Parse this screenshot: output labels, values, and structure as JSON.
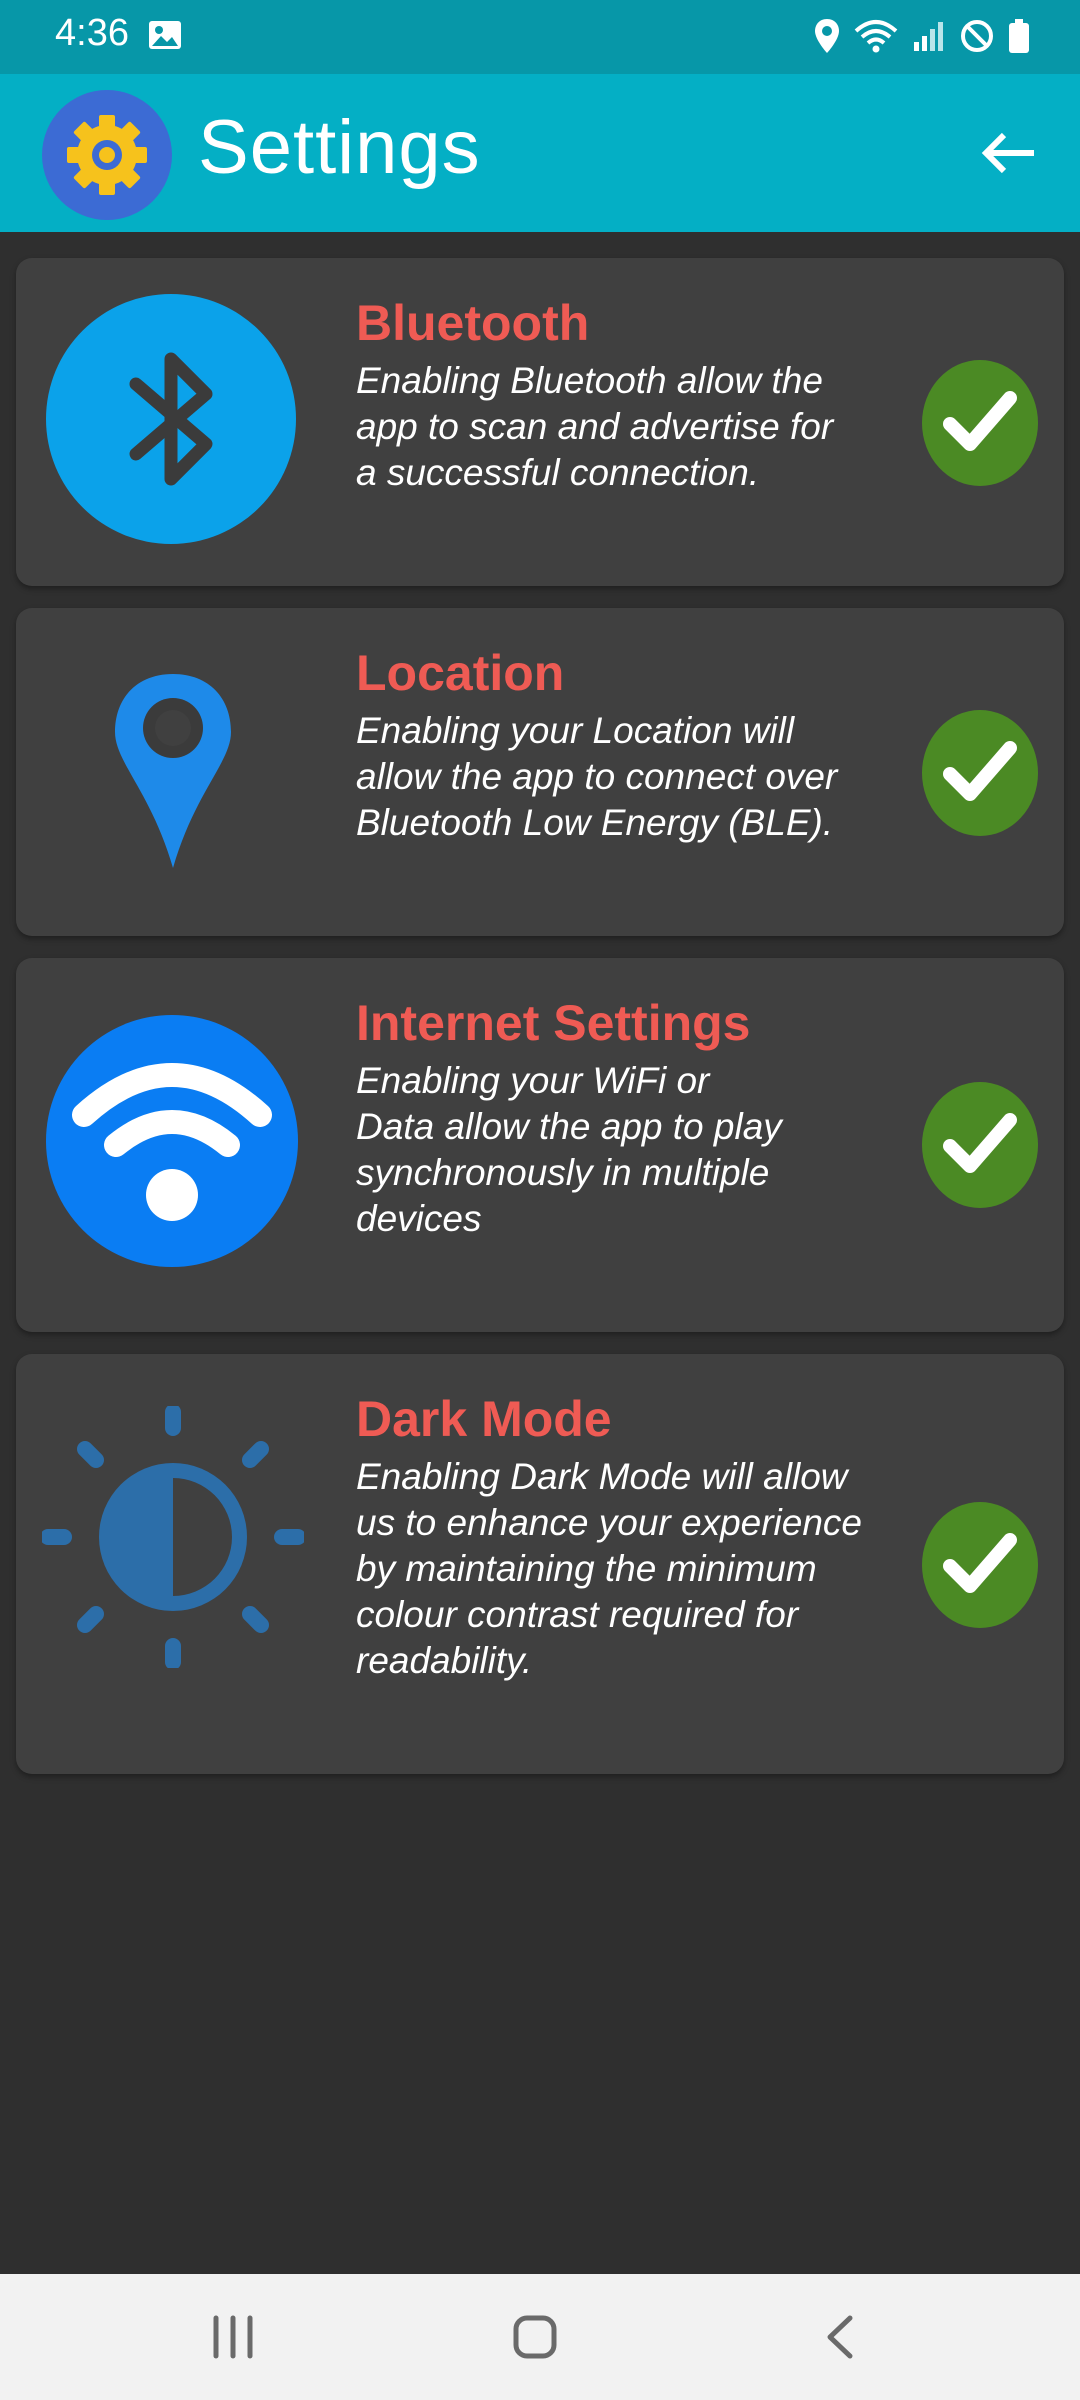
{
  "status_bar": {
    "time": "4:36",
    "icons": [
      "gallery-icon",
      "location-icon",
      "wifi-icon",
      "signal-icon",
      "do-not-disturb-icon",
      "battery-icon"
    ]
  },
  "app_bar": {
    "title": "Settings",
    "logo_icon": "gear-icon",
    "back_icon": "arrow-left-icon",
    "background_color": "#04afc5"
  },
  "settings": [
    {
      "title": "Bluetooth",
      "description": "Enabling Bluetooth allow the\napp to scan and advertise for\na successful connection.",
      "icon": "bluetooth-icon",
      "enabled": true
    },
    {
      "title": "Location",
      "description": "Enabling your Location will\nallow the app to connect over\nBluetooth Low Energy (BLE).",
      "icon": "location-pin-icon",
      "enabled": true
    },
    {
      "title": "Internet Settings",
      "description": "Enabling your WiFi or\nData allow the app to play\nsynchronously in multiple\ndevices",
      "icon": "wifi-icon",
      "enabled": true
    },
    {
      "title": "Dark Mode",
      "description": "Enabling Dark Mode will allow\nus to enhance your experience\nby maintaining the minimum\ncolour contrast required for\nreadability.",
      "icon": "brightness-contrast-icon",
      "enabled": true
    }
  ],
  "colors": {
    "title_accent": "#ef5b54",
    "check_green": "#4b8a24",
    "card_background": "#404040",
    "page_background": "#2f2f2f"
  },
  "nav_bar": {
    "buttons": [
      "recent-apps-icon",
      "home-icon",
      "back-icon"
    ]
  }
}
